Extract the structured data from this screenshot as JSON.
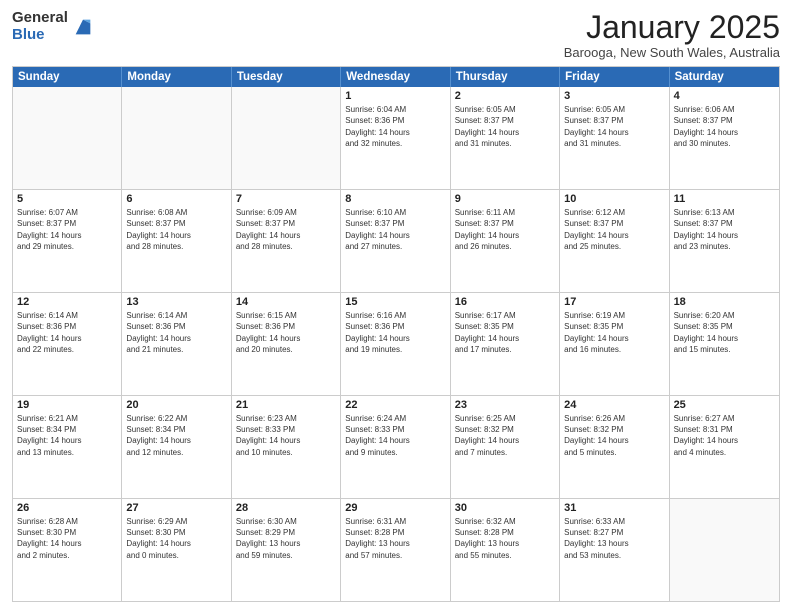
{
  "logo": {
    "general": "General",
    "blue": "Blue"
  },
  "title": "January 2025",
  "location": "Barooga, New South Wales, Australia",
  "weekdays": [
    "Sunday",
    "Monday",
    "Tuesday",
    "Wednesday",
    "Thursday",
    "Friday",
    "Saturday"
  ],
  "rows": [
    [
      {
        "day": "",
        "text": ""
      },
      {
        "day": "",
        "text": ""
      },
      {
        "day": "",
        "text": ""
      },
      {
        "day": "1",
        "text": "Sunrise: 6:04 AM\nSunset: 8:36 PM\nDaylight: 14 hours\nand 32 minutes."
      },
      {
        "day": "2",
        "text": "Sunrise: 6:05 AM\nSunset: 8:37 PM\nDaylight: 14 hours\nand 31 minutes."
      },
      {
        "day": "3",
        "text": "Sunrise: 6:05 AM\nSunset: 8:37 PM\nDaylight: 14 hours\nand 31 minutes."
      },
      {
        "day": "4",
        "text": "Sunrise: 6:06 AM\nSunset: 8:37 PM\nDaylight: 14 hours\nand 30 minutes."
      }
    ],
    [
      {
        "day": "5",
        "text": "Sunrise: 6:07 AM\nSunset: 8:37 PM\nDaylight: 14 hours\nand 29 minutes."
      },
      {
        "day": "6",
        "text": "Sunrise: 6:08 AM\nSunset: 8:37 PM\nDaylight: 14 hours\nand 28 minutes."
      },
      {
        "day": "7",
        "text": "Sunrise: 6:09 AM\nSunset: 8:37 PM\nDaylight: 14 hours\nand 28 minutes."
      },
      {
        "day": "8",
        "text": "Sunrise: 6:10 AM\nSunset: 8:37 PM\nDaylight: 14 hours\nand 27 minutes."
      },
      {
        "day": "9",
        "text": "Sunrise: 6:11 AM\nSunset: 8:37 PM\nDaylight: 14 hours\nand 26 minutes."
      },
      {
        "day": "10",
        "text": "Sunrise: 6:12 AM\nSunset: 8:37 PM\nDaylight: 14 hours\nand 25 minutes."
      },
      {
        "day": "11",
        "text": "Sunrise: 6:13 AM\nSunset: 8:37 PM\nDaylight: 14 hours\nand 23 minutes."
      }
    ],
    [
      {
        "day": "12",
        "text": "Sunrise: 6:14 AM\nSunset: 8:36 PM\nDaylight: 14 hours\nand 22 minutes."
      },
      {
        "day": "13",
        "text": "Sunrise: 6:14 AM\nSunset: 8:36 PM\nDaylight: 14 hours\nand 21 minutes."
      },
      {
        "day": "14",
        "text": "Sunrise: 6:15 AM\nSunset: 8:36 PM\nDaylight: 14 hours\nand 20 minutes."
      },
      {
        "day": "15",
        "text": "Sunrise: 6:16 AM\nSunset: 8:36 PM\nDaylight: 14 hours\nand 19 minutes."
      },
      {
        "day": "16",
        "text": "Sunrise: 6:17 AM\nSunset: 8:35 PM\nDaylight: 14 hours\nand 17 minutes."
      },
      {
        "day": "17",
        "text": "Sunrise: 6:19 AM\nSunset: 8:35 PM\nDaylight: 14 hours\nand 16 minutes."
      },
      {
        "day": "18",
        "text": "Sunrise: 6:20 AM\nSunset: 8:35 PM\nDaylight: 14 hours\nand 15 minutes."
      }
    ],
    [
      {
        "day": "19",
        "text": "Sunrise: 6:21 AM\nSunset: 8:34 PM\nDaylight: 14 hours\nand 13 minutes."
      },
      {
        "day": "20",
        "text": "Sunrise: 6:22 AM\nSunset: 8:34 PM\nDaylight: 14 hours\nand 12 minutes."
      },
      {
        "day": "21",
        "text": "Sunrise: 6:23 AM\nSunset: 8:33 PM\nDaylight: 14 hours\nand 10 minutes."
      },
      {
        "day": "22",
        "text": "Sunrise: 6:24 AM\nSunset: 8:33 PM\nDaylight: 14 hours\nand 9 minutes."
      },
      {
        "day": "23",
        "text": "Sunrise: 6:25 AM\nSunset: 8:32 PM\nDaylight: 14 hours\nand 7 minutes."
      },
      {
        "day": "24",
        "text": "Sunrise: 6:26 AM\nSunset: 8:32 PM\nDaylight: 14 hours\nand 5 minutes."
      },
      {
        "day": "25",
        "text": "Sunrise: 6:27 AM\nSunset: 8:31 PM\nDaylight: 14 hours\nand 4 minutes."
      }
    ],
    [
      {
        "day": "26",
        "text": "Sunrise: 6:28 AM\nSunset: 8:30 PM\nDaylight: 14 hours\nand 2 minutes."
      },
      {
        "day": "27",
        "text": "Sunrise: 6:29 AM\nSunset: 8:30 PM\nDaylight: 14 hours\nand 0 minutes."
      },
      {
        "day": "28",
        "text": "Sunrise: 6:30 AM\nSunset: 8:29 PM\nDaylight: 13 hours\nand 59 minutes."
      },
      {
        "day": "29",
        "text": "Sunrise: 6:31 AM\nSunset: 8:28 PM\nDaylight: 13 hours\nand 57 minutes."
      },
      {
        "day": "30",
        "text": "Sunrise: 6:32 AM\nSunset: 8:28 PM\nDaylight: 13 hours\nand 55 minutes."
      },
      {
        "day": "31",
        "text": "Sunrise: 6:33 AM\nSunset: 8:27 PM\nDaylight: 13 hours\nand 53 minutes."
      },
      {
        "day": "",
        "text": ""
      }
    ]
  ]
}
